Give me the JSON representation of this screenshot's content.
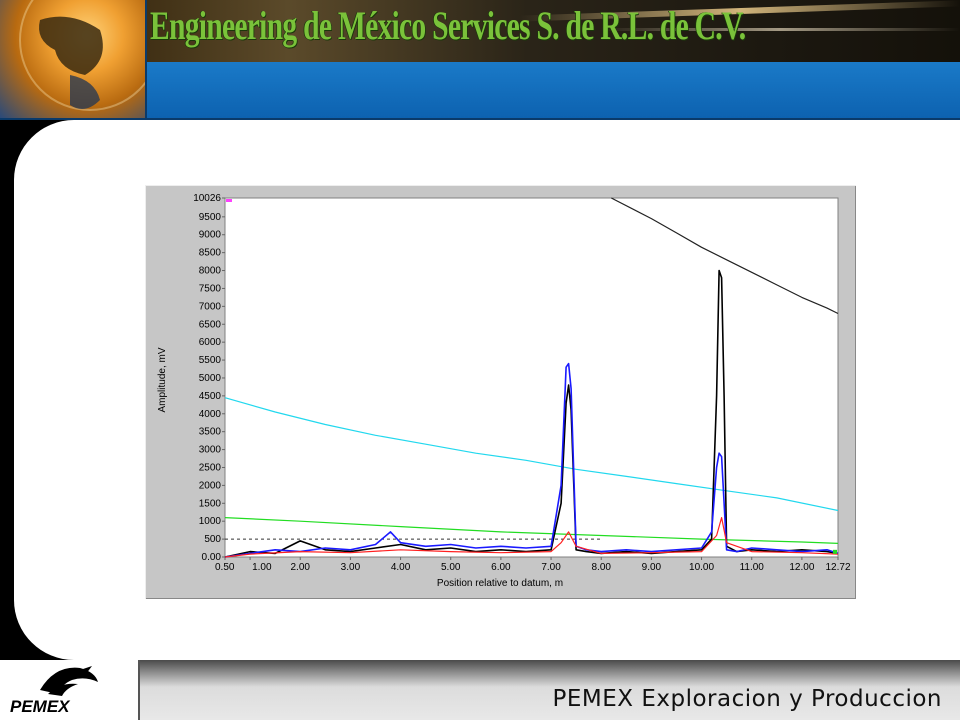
{
  "header": {
    "title": "Engineering de México Services S. de R.L. de C.V."
  },
  "footer": {
    "logo_text": "PEMEX",
    "tagline": "PEMEX Exploracion y Produccion"
  },
  "colors": {
    "black_series": "#000000",
    "blue_series": "#1a1aff",
    "red_series": "#ff2020",
    "cyan_series": "#22d8ee",
    "green_series": "#22dd22",
    "gray_series": "#222222",
    "header_band": "#1a7ac8",
    "title_green": "#7ac23a"
  },
  "chart_data": {
    "type": "line",
    "xlabel": "Position relative to datum, m",
    "ylabel": "Amplitude, mV",
    "xlim": [
      0.5,
      12.72
    ],
    "ylim": [
      0,
      10026
    ],
    "x_tick_labels": [
      "0.50",
      "1.00",
      "2.00",
      "3.00",
      "4.00",
      "5.00",
      "6.00",
      "7.00",
      "8.00",
      "9.00",
      "10.00",
      "11.00",
      "12.00",
      "12.72"
    ],
    "y_tick_labels": [
      "10026",
      "9500",
      "9000",
      "8500",
      "8000",
      "7500",
      "7000",
      "6500",
      "6000",
      "5500",
      "5000",
      "4500",
      "4000",
      "3500",
      "3000",
      "2500",
      "2000",
      "1500",
      "1000",
      "500",
      "0.00"
    ],
    "grid": false,
    "reference_line": {
      "y": 500,
      "style": "dashed"
    },
    "series": [
      {
        "color_key": "gray_series",
        "x": [
          8.2,
          9.0,
          9.5,
          10.0,
          10.5,
          11.0,
          11.5,
          12.0,
          12.5,
          12.72
        ],
        "y": [
          10026,
          9450,
          9050,
          8650,
          8300,
          7950,
          7600,
          7250,
          6950,
          6800
        ]
      },
      {
        "color_key": "cyan_series",
        "x": [
          0.5,
          1.5,
          2.5,
          3.5,
          4.5,
          5.5,
          6.5,
          7.5,
          8.5,
          9.5,
          10.5,
          11.5,
          12.72
        ],
        "y": [
          4450,
          4050,
          3700,
          3400,
          3150,
          2900,
          2700,
          2450,
          2250,
          2050,
          1850,
          1650,
          1300
        ]
      },
      {
        "color_key": "green_series",
        "x": [
          0.5,
          2.0,
          4.0,
          6.0,
          8.0,
          10.0,
          12.0,
          12.72
        ],
        "y": [
          1100,
          1000,
          850,
          700,
          600,
          500,
          420,
          380
        ]
      },
      {
        "color_key": "black_series",
        "x": [
          0.5,
          1.0,
          1.5,
          2.0,
          2.5,
          3.0,
          3.5,
          4.0,
          4.5,
          5.0,
          5.5,
          6.0,
          6.5,
          7.0,
          7.2,
          7.3,
          7.35,
          7.4,
          7.5,
          7.7,
          8.0,
          8.5,
          9.0,
          9.5,
          10.0,
          10.2,
          10.3,
          10.35,
          10.4,
          10.45,
          10.5,
          10.7,
          11.0,
          11.5,
          12.0,
          12.5,
          12.72
        ],
        "y": [
          0,
          150,
          100,
          450,
          200,
          150,
          250,
          350,
          200,
          250,
          150,
          200,
          150,
          200,
          1500,
          4300,
          4800,
          4100,
          200,
          150,
          100,
          150,
          100,
          150,
          200,
          500,
          4500,
          8000,
          7800,
          4500,
          300,
          150,
          200,
          150,
          200,
          150,
          100
        ]
      },
      {
        "color_key": "blue_series",
        "x": [
          0.5,
          1.0,
          1.5,
          2.0,
          2.5,
          3.0,
          3.5,
          3.8,
          4.0,
          4.5,
          5.0,
          5.5,
          6.0,
          6.5,
          7.0,
          7.2,
          7.3,
          7.35,
          7.4,
          7.5,
          7.7,
          8.0,
          8.5,
          9.0,
          9.5,
          10.0,
          10.2,
          10.3,
          10.35,
          10.4,
          10.45,
          10.5,
          10.7,
          11.0,
          11.5,
          12.0,
          12.5,
          12.72
        ],
        "y": [
          0,
          100,
          200,
          150,
          250,
          200,
          350,
          700,
          400,
          300,
          350,
          250,
          300,
          250,
          300,
          2000,
          5300,
          5400,
          4700,
          300,
          200,
          150,
          200,
          150,
          200,
          250,
          700,
          2500,
          2900,
          2800,
          1500,
          200,
          150,
          250,
          200,
          150,
          200,
          100
        ]
      },
      {
        "color_key": "red_series",
        "x": [
          0.5,
          1.0,
          2.0,
          3.0,
          4.0,
          5.0,
          6.0,
          7.0,
          7.2,
          7.35,
          7.5,
          8.0,
          9.0,
          10.0,
          10.3,
          10.4,
          10.5,
          11.0,
          12.0,
          12.72
        ],
        "y": [
          0,
          80,
          150,
          120,
          200,
          150,
          120,
          150,
          400,
          700,
          300,
          100,
          120,
          150,
          600,
          1100,
          400,
          150,
          120,
          80
        ]
      }
    ]
  }
}
